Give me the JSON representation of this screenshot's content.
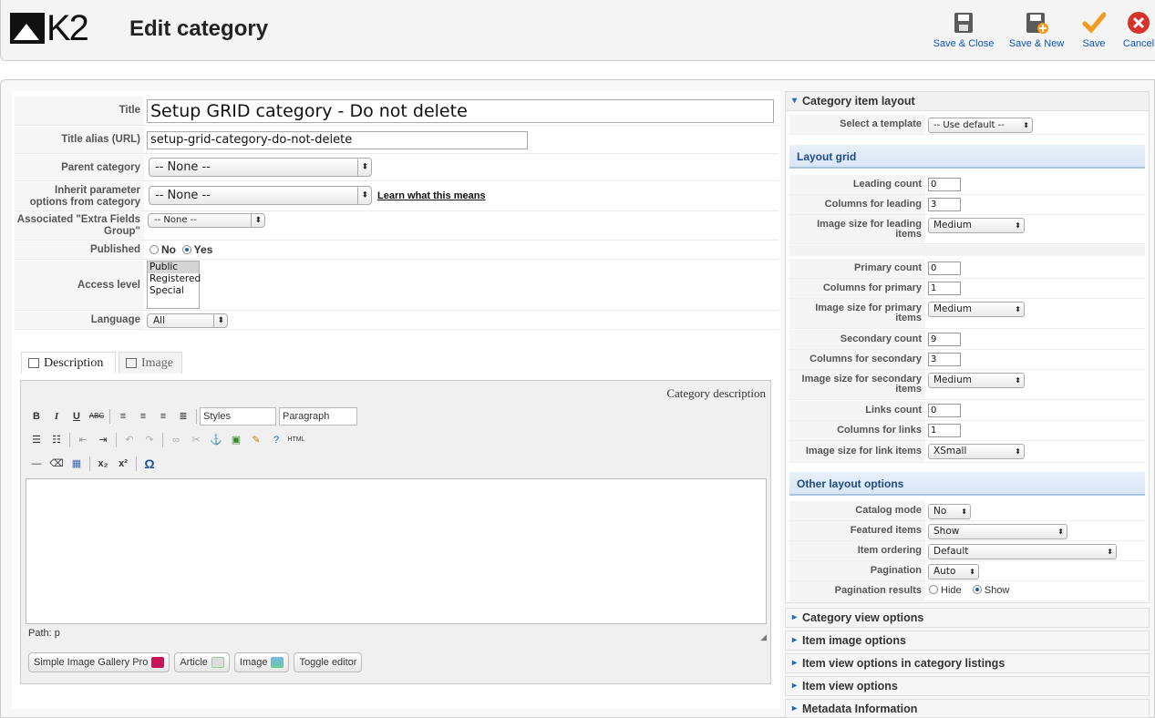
{
  "header": {
    "logo_text": "K2",
    "page_title": "Edit category",
    "buttons": [
      {
        "label": "Save & Close",
        "icon": "save-icon"
      },
      {
        "label": "Save & New",
        "icon": "save-new-icon"
      },
      {
        "label": "Save",
        "icon": "check-icon"
      },
      {
        "label": "Cancel",
        "icon": "cancel-icon"
      }
    ]
  },
  "form": {
    "title_label": "Title",
    "title_value": "Setup GRID category - Do not delete",
    "alias_label": "Title alias (URL)",
    "alias_value": "setup-grid-category-do-not-delete",
    "parent_label": "Parent category",
    "parent_value": "-- None --",
    "inherit_label": "Inherit parameter options from category",
    "inherit_value": "-- None --",
    "inherit_link": "Learn what this means",
    "extra_label": "Associated \"Extra Fields Group\"",
    "extra_value": "-- None --",
    "published_label": "Published",
    "published_no": "No",
    "published_yes": "Yes",
    "access_label": "Access level",
    "access_options": [
      "Public",
      "Registered",
      "Special"
    ],
    "language_label": "Language",
    "language_value": "All"
  },
  "tabs": [
    {
      "label": "Description"
    },
    {
      "label": "Image"
    }
  ],
  "editor": {
    "heading": "Category description",
    "styles": "Styles",
    "paragraph": "Paragraph",
    "path": "Path: p",
    "buttons": [
      "Simple Image Gallery Pro",
      "Article",
      "Image",
      "Toggle editor"
    ]
  },
  "right": {
    "accordion_open": "Category item layout",
    "template_label": "Select a template",
    "template_value": "-- Use default --",
    "layout_grid": "Layout grid",
    "rows1": [
      {
        "label": "Leading count",
        "value": "0"
      },
      {
        "label": "Columns for leading",
        "value": "3"
      }
    ],
    "img_leading_label": "Image size for leading items",
    "img_leading_value": "Medium",
    "rows2": [
      {
        "label": "Primary count",
        "value": "0"
      },
      {
        "label": "Columns for primary",
        "value": "1"
      }
    ],
    "img_primary_label": "Image size for primary items",
    "img_primary_value": "Medium",
    "rows3": [
      {
        "label": "Secondary count",
        "value": "9"
      },
      {
        "label": "Columns for secondary",
        "value": "3"
      }
    ],
    "img_secondary_label": "Image size for secondary items",
    "img_secondary_value": "Medium",
    "rows4": [
      {
        "label": "Links count",
        "value": "0"
      },
      {
        "label": "Columns for links",
        "value": "1"
      }
    ],
    "img_links_label": "Image size for link items",
    "img_links_value": "XSmall",
    "other": "Other layout options",
    "catalog_label": "Catalog mode",
    "catalog_value": "No",
    "featured_label": "Featured items",
    "featured_value": "Show",
    "ordering_label": "Item ordering",
    "ordering_value": "Default",
    "pagination_label": "Pagination",
    "pagination_value": "Auto",
    "presults_label": "Pagination results",
    "presults_hide": "Hide",
    "presults_show": "Show",
    "collapsed": [
      "Category view options",
      "Item image options",
      "Item view options in category listings",
      "Item view options",
      "Metadata Information"
    ]
  }
}
